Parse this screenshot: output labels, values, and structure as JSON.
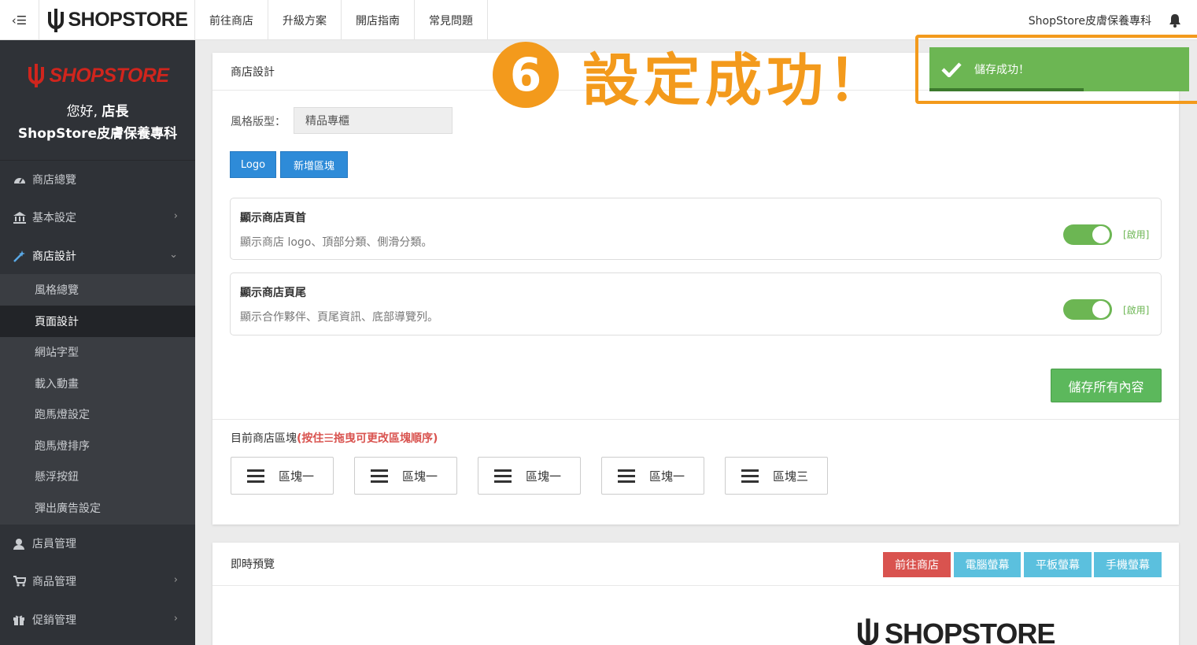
{
  "topbar": {
    "brand": "SHOPSTORE",
    "nav": [
      "前往商店",
      "升級方案",
      "開店指南",
      "常見問題"
    ],
    "shop_name": "ShopStore皮膚保養專科"
  },
  "sidebar": {
    "logo": "SHOPSTORE",
    "greeting": "您好,",
    "role": "店長",
    "store_name": "ShopStore皮膚保養專科",
    "items": [
      {
        "label": "商店總覽"
      },
      {
        "label": "基本設定"
      },
      {
        "label": "商店設計"
      },
      {
        "label": "店員管理"
      },
      {
        "label": "商品管理"
      },
      {
        "label": "促銷管理"
      }
    ],
    "submenu": [
      "風格總覽",
      "頁面設計",
      "網站字型",
      "載入動畫",
      "跑馬燈設定",
      "跑馬燈排序",
      "懸浮按鈕",
      "彈出廣告設定"
    ]
  },
  "design_panel": {
    "title": "商店設計",
    "style_label": "風格版型：",
    "style_value": "精品專櫃",
    "logo_btn": "Logo",
    "add_block_btn": "新增區塊",
    "cards": [
      {
        "title": "顯示商店頁首",
        "desc": "顯示商店 logo、頂部分類、側滑分類。",
        "status": "[啟用]",
        "enabled": true
      },
      {
        "title": "顯示商店頁尾",
        "desc": "顯示合作夥伴、頁尾資訊、底部導覽列。",
        "status": "[啟用]",
        "enabled": true
      }
    ],
    "save_btn": "儲存所有內容",
    "blocks_title": "目前商店區塊",
    "blocks_hint": "(按住☰拖曳可更改區塊順序)",
    "blocks": [
      "區塊一",
      "區塊一",
      "區塊一",
      "區塊一",
      "區塊三"
    ]
  },
  "preview_panel": {
    "title": "即時預覽",
    "buttons": [
      "前往商店",
      "電腦螢幕",
      "平板螢幕",
      "手機螢幕"
    ],
    "preview_logo": "SHOPSTORE"
  },
  "toast": {
    "message": "儲存成功！"
  },
  "annotation": {
    "number": "6",
    "text": "設定成功！"
  },
  "colors": {
    "sidebar": "#2f3237",
    "success": "#6cb653",
    "annotation": "#f39a1c",
    "primary": "#2e8bd8",
    "danger": "#d9534f",
    "info": "#5bc0de"
  }
}
